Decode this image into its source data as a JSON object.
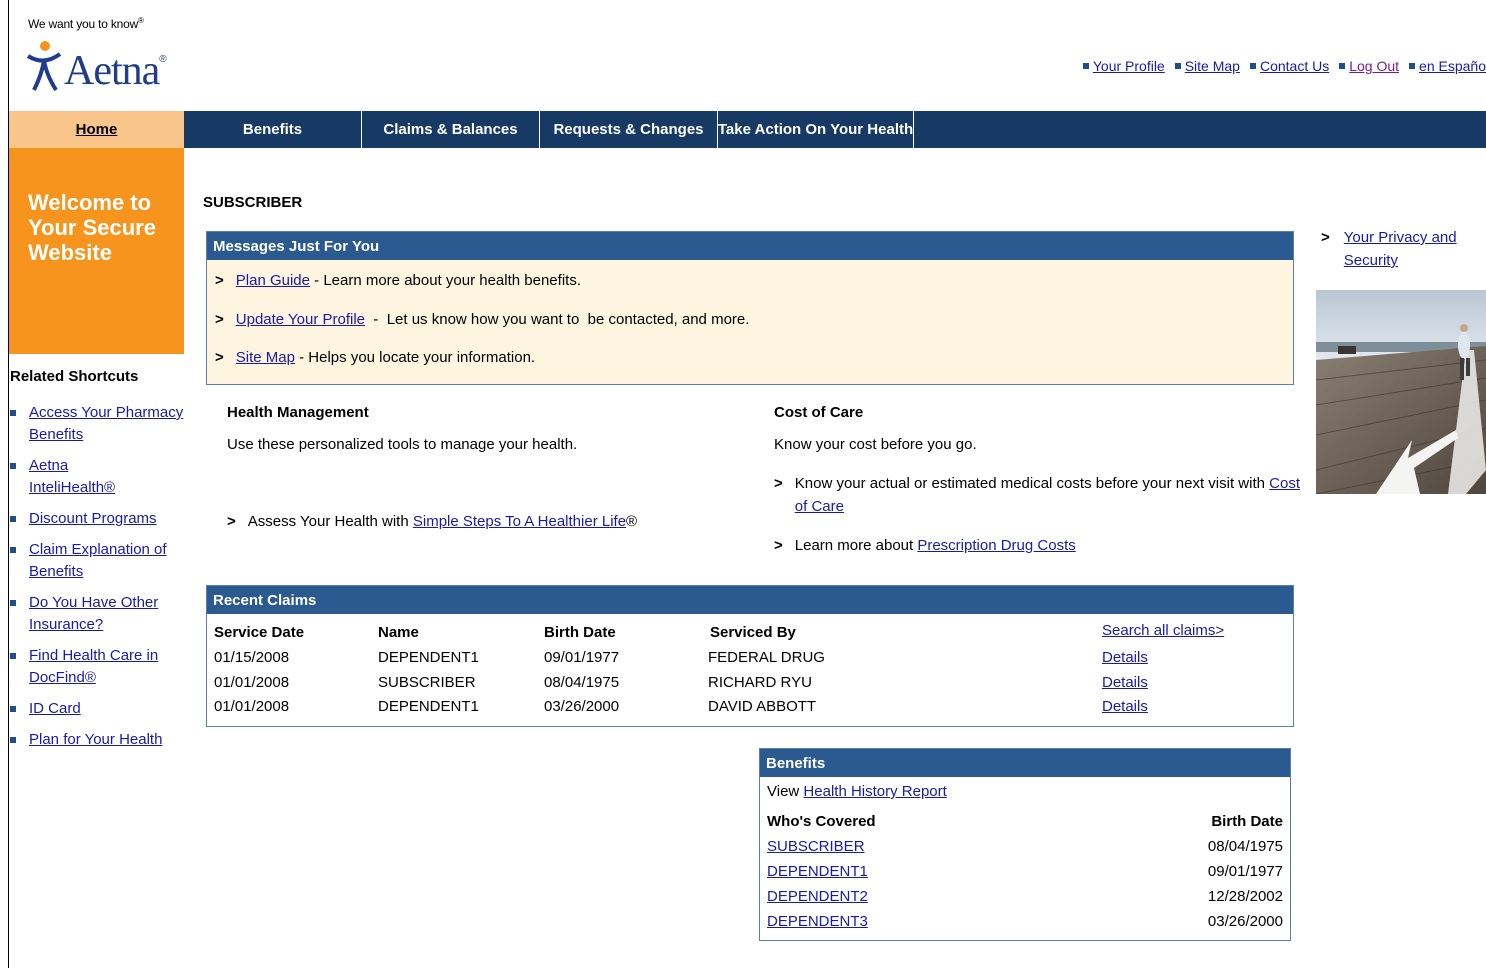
{
  "header": {
    "tagline": "We want you to know",
    "tagline_mark": "®",
    "logo_text": "Aetna",
    "logo_reg": "®",
    "links": [
      {
        "label": "Your Profile"
      },
      {
        "label": "Site Map"
      },
      {
        "label": "Contact Us"
      },
      {
        "label": "Log Out"
      },
      {
        "label": "en Españo"
      }
    ]
  },
  "nav": {
    "home": "Home",
    "tabs": [
      "Benefits",
      "Claims & Balances",
      "Requests & Changes",
      "Take Action On Your Health"
    ]
  },
  "left": {
    "welcome_lines": [
      "Welcome to",
      "Your Secure",
      "Website"
    ],
    "shortcuts_title": "Related Shortcuts",
    "shortcuts": [
      {
        "line1": "Access Your Pharmacy",
        "line2": "Benefits"
      },
      {
        "line1": "Aetna",
        "line2": "InteliHealth®"
      },
      {
        "line1": "Discount Programs",
        "line2": ""
      },
      {
        "line1": "Claim Explanation of",
        "line2": "Benefits"
      },
      {
        "line1": "Do You Have Other",
        "line2": "Insurance?"
      },
      {
        "line1": "Find Health Care in",
        "line2": "DocFind®"
      },
      {
        "line1": "ID Card",
        "line2": ""
      },
      {
        "line1": "Plan for Your Health",
        "line2": ""
      }
    ]
  },
  "main": {
    "subscriber_label": "SUBSCRIBER",
    "messages": {
      "title": "Messages Just For You",
      "items": [
        {
          "link": "Plan Guide",
          "text": " - Learn more about your health benefits."
        },
        {
          "link": "Update Your Profile",
          "text": "  -  Let us know how you want to  be contacted, and more."
        },
        {
          "link": "Site Map",
          "text": " - Helps you locate your information."
        }
      ]
    },
    "health_management": {
      "title": "Health Management",
      "desc": "Use these personalized tools to manage your health.",
      "item_prefix": "Assess Your Health with ",
      "item_link": "Simple Steps To A Healthier Life",
      "item_suffix": "®"
    },
    "cost_of_care": {
      "title": "Cost of Care",
      "desc": "Know your cost before you go.",
      "item1_text": "Know your actual or estimated medical costs before your next visit with ",
      "item1_link_a": "Cost",
      "item1_link_b": "of Care",
      "item2_text": "Learn more about ",
      "item2_link": "Prescription Drug Costs"
    },
    "recent_claims": {
      "title": "Recent Claims",
      "headers": {
        "service_date": "Service Date",
        "name": "Name",
        "birth_date": "Birth Date",
        "serviced_by": "Serviced By"
      },
      "search_link": "Search all claims>",
      "rows": [
        {
          "service_date": "01/15/2008",
          "name": "DEPENDENT1",
          "birth_date": "09/01/1977",
          "serviced_by": "FEDERAL DRUG",
          "action": "Details"
        },
        {
          "service_date": "01/01/2008",
          "name": "SUBSCRIBER",
          "birth_date": "08/04/1975",
          "serviced_by": "RICHARD RYU",
          "action": "Details"
        },
        {
          "service_date": "01/01/2008",
          "name": "DEPENDENT1",
          "birth_date": "03/26/2000",
          "serviced_by": "DAVID ABBOTT",
          "action": "Details"
        }
      ]
    },
    "benefits": {
      "title": "Benefits",
      "view_prefix": "View ",
      "view_link": "Health History Report",
      "col_covered": "Who's Covered",
      "col_birth": "Birth Date",
      "rows": [
        {
          "name": "SUBSCRIBER",
          "birth_date": "08/04/1975"
        },
        {
          "name": "DEPENDENT1",
          "birth_date": "09/01/1977"
        },
        {
          "name": "DEPENDENT2",
          "birth_date": "12/28/2002"
        },
        {
          "name": "DEPENDENT3",
          "birth_date": "03/26/2000"
        }
      ]
    }
  },
  "right": {
    "privacy_line1": "Your Privacy and",
    "privacy_line2": "Security"
  },
  "chevron": ">",
  "colors": {
    "nav_bg": "#173a64",
    "home_tab": "#f9c58a",
    "welcome_bg": "#f7941d",
    "box_head": "#2a5a8f",
    "messages_bg": "#fdf5df",
    "link": "#1a1aa8"
  }
}
